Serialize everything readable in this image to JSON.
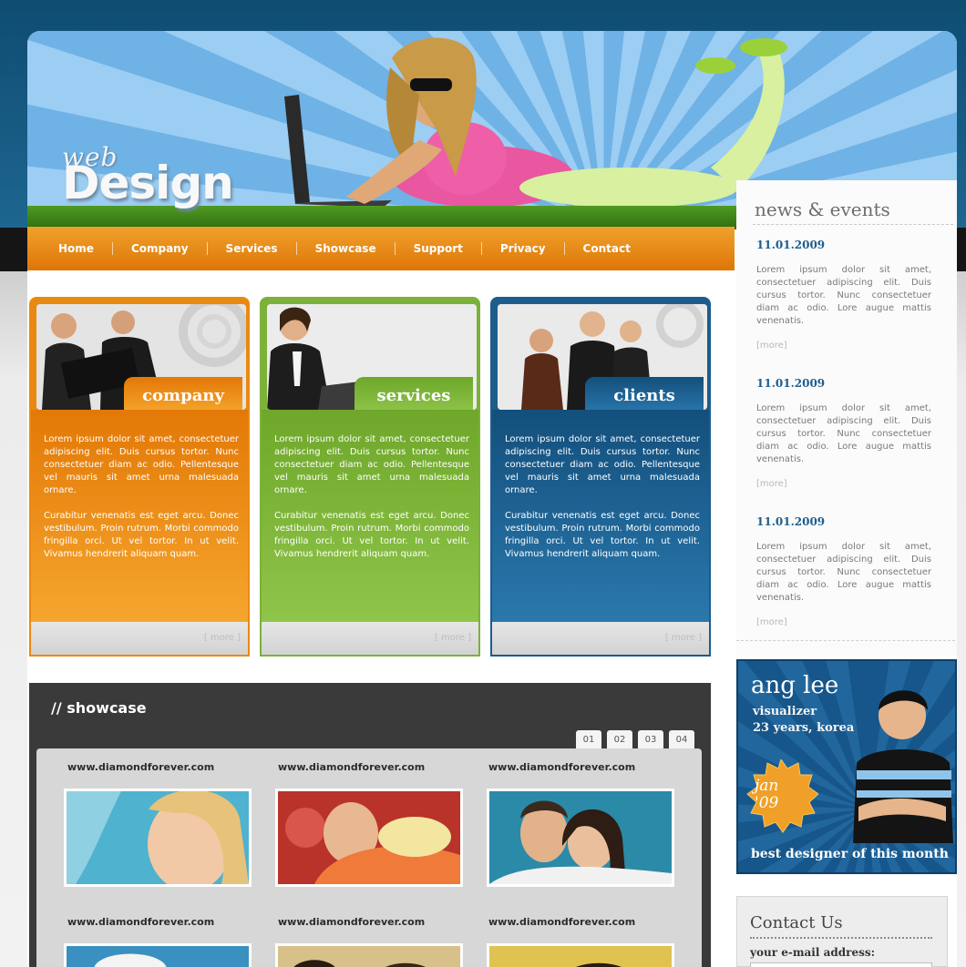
{
  "logo": {
    "small": "web",
    "large": "Design"
  },
  "nav": [
    "Home",
    "Company",
    "Services",
    "Showcase",
    "Support",
    "Privacy",
    "Contact"
  ],
  "boxes": [
    {
      "title": "company",
      "p1": "Lorem ipsum dolor sit amet, consectetuer adipiscing elit. Duis cursus tortor. Nunc consectetuer diam ac odio. Pellentesque vel mauris sit amet urna malesuada ornare.",
      "p2": "Curabitur venenatis est eget arcu. Donec vestibulum. Proin rutrum. Morbi commodo fringilla orci. Ut vel tortor. In ut velit. Vivamus hendrerit aliquam quam.",
      "more": "[ more ]"
    },
    {
      "title": "services",
      "p1": "Lorem ipsum dolor sit amet, consectetuer adipiscing elit. Duis cursus tortor. Nunc consectetuer diam ac odio. Pellentesque vel mauris sit amet urna malesuada ornare.",
      "p2": "Curabitur venenatis est eget arcu. Donec vestibulum. Proin rutrum. Morbi commodo fringilla orci. Ut vel tortor. In ut velit. Vivamus hendrerit aliquam quam.",
      "more": "[ more ]"
    },
    {
      "title": "clients",
      "p1": "Lorem ipsum dolor sit amet, consectetuer adipiscing elit. Duis cursus tortor. Nunc consectetuer diam ac odio. Pellentesque vel mauris sit amet urna malesuada ornare.",
      "p2": "Curabitur venenatis est eget arcu. Donec vestibulum. Proin rutrum. Morbi commodo fringilla orci. Ut vel tortor. In ut velit. Vivamus hendrerit aliquam quam.",
      "more": "[ more ]"
    }
  ],
  "news": {
    "title": "news & events",
    "items": [
      {
        "date": "11.01.2009",
        "text": "Lorem ipsum dolor sit amet, consectetuer adipiscing elit. Duis cursus tortor. Nunc consectetuer diam ac odio. Lore augue mattis venenatis.",
        "more": "[more]"
      },
      {
        "date": "11.01.2009",
        "text": "Lorem ipsum dolor sit amet, consectetuer adipiscing elit. Duis cursus tortor. Nunc consectetuer diam ac odio. Lore augue mattis venenatis.",
        "more": "[more]"
      },
      {
        "date": "11.01.2009",
        "text": "Lorem ipsum dolor sit amet, consectetuer adipiscing elit. Duis cursus tortor. Nunc consectetuer diam ac odio. Lore augue mattis venenatis.",
        "more": "[more]"
      }
    ]
  },
  "showcase": {
    "title": "// showcase",
    "pages": [
      "01",
      "02",
      "03",
      "04"
    ],
    "urls": [
      "www.diamondforever.com",
      "www.diamondforever.com",
      "www.diamondforever.com",
      "www.diamondforever.com",
      "www.diamondforever.com",
      "www.diamondforever.com"
    ]
  },
  "profile": {
    "name": "ang lee",
    "role": "visualizer",
    "info": "23 years, korea",
    "badge_line1": "jan",
    "badge_line2": "'09",
    "caption": "best designer of this month"
  },
  "contact": {
    "title": "Contact Us",
    "label": "your e-mail address:"
  },
  "colors": {
    "orange": "#e88a12",
    "green": "#7cb13a",
    "blue": "#1c5d8c",
    "header_blue": "#1d6690"
  }
}
